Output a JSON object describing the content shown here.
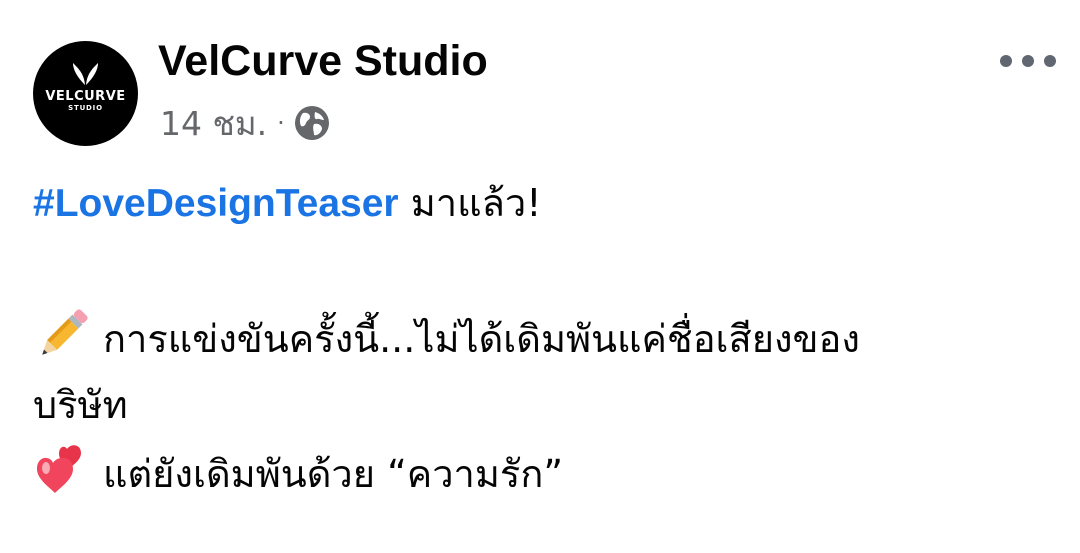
{
  "post": {
    "page_name": "VelCurve Studio",
    "avatar": {
      "logo_main": "VELCURVE",
      "logo_sub": "STUDIO"
    },
    "timestamp": "14 ชม.",
    "separator": "·",
    "privacy_icon": "globe-icon",
    "more_icon": "more-options-icon",
    "hashtag": "#LoveDesignTeaser",
    "line1_text": " มาแล้ว!",
    "line2_emoji": "pencil-emoji",
    "line2_text": "การแข่งขันครั้งนี้...ไม่ได้เดิมพันแค่ชื่อเสียงของ",
    "line3_text": "บริษัท",
    "line4_emoji": "two-hearts-emoji",
    "line4_text": "แต่ยังเดิมพันด้วย “ความรัก”"
  },
  "colors": {
    "hashtag": "#1b74e4",
    "meta_text": "#65676b",
    "name_text": "#050505"
  }
}
